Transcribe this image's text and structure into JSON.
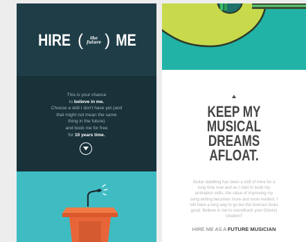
{
  "left_card": {
    "title": {
      "word_left": "HIRE",
      "paren_open": "(",
      "tiny_top": "the",
      "tiny_bottom": "future",
      "paren_close": ")",
      "word_right": "ME"
    },
    "pitch": {
      "line1": "This is your chance",
      "line2_pre": "to ",
      "line2_strong": "believe in me.",
      "line3": "Choose a skill I don't have yet (and",
      "line4": "that might not mean the same",
      "line5": "thing in the future)",
      "line6": "and book me for free",
      "line7_pre": "for ",
      "line7_strong": "10 years time."
    },
    "scroll_icon": "chevron-down-circle",
    "colors": {
      "dark_band": "#1f3d47",
      "body": "#19323a",
      "teal": "#3fbcc2",
      "podium": "#e8653a"
    }
  },
  "right_card": {
    "headline": [
      "KEEP MY",
      "MUSICAL",
      "DREAMS",
      "AFLOAT."
    ],
    "story": {
      "line1": "Guitar dabbling has been a skill of mine for a",
      "line2": "long time now and as I start to build my",
      "line3": "animation skills, the value of improving my",
      "line4": "song writing becomes more and more evident. I",
      "line5": "still have a long way to go but the forecast looks",
      "line6": "good. Believe in me to soundtrack your (future)",
      "line7": "creation?"
    },
    "cta": {
      "prefix": "HIRE ME AS A ",
      "role": "FUTURE MUSICIAN"
    },
    "colors": {
      "teal": "#21b3a6",
      "guitar_body": "#c8d94c",
      "headline": "#454545"
    }
  }
}
